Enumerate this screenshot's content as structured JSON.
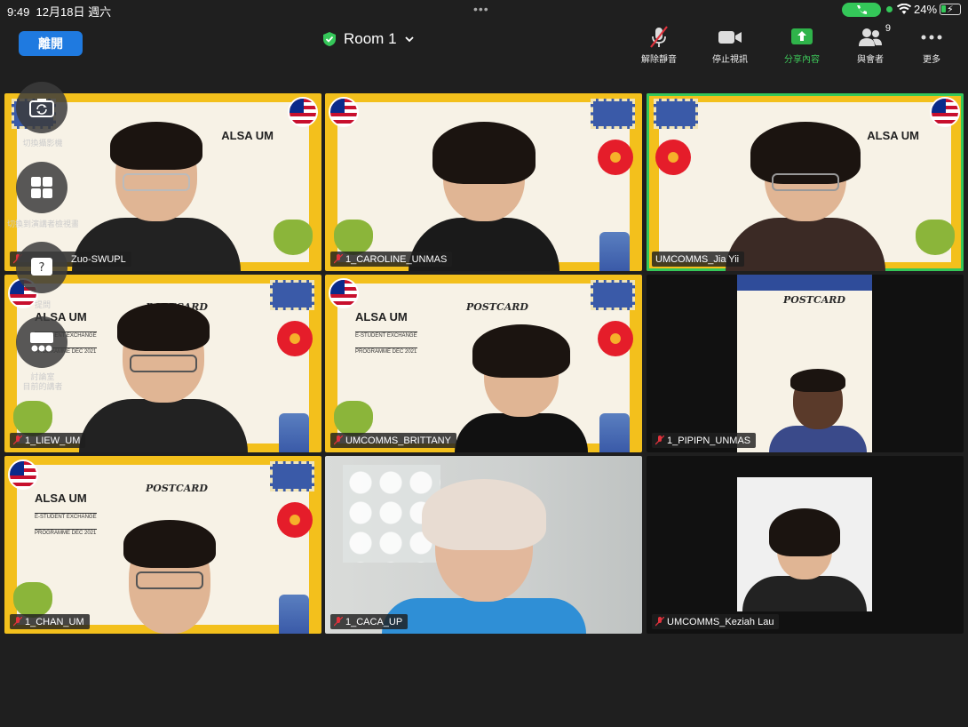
{
  "status_bar": {
    "time": "9:49",
    "date": "12月18日 週六",
    "battery_percent": "24%",
    "battery_level": 0.24
  },
  "toolbar": {
    "leave_label": "離開",
    "room_name": "Room 1",
    "items": [
      {
        "label": "解除靜音",
        "icon": "mic-muted-icon"
      },
      {
        "label": "停止視訊",
        "icon": "video-camera-icon"
      },
      {
        "label": "分享內容",
        "icon": "share-screen-icon"
      },
      {
        "label": "與會者",
        "icon": "participants-icon",
        "count": "9"
      },
      {
        "label": "更多",
        "icon": "more-icon"
      }
    ]
  },
  "participants": [
    {
      "name": "Zuo-SWUPL",
      "muted": true
    },
    {
      "name": "1_CAROLINE_UNMAS",
      "muted": true
    },
    {
      "name": "UMCOMMS_Jia Yii",
      "muted": false,
      "active_speaker": true
    },
    {
      "name": "1_LIEW_UM",
      "muted": true
    },
    {
      "name": "UMCOMMS_BRITTANY",
      "muted": true
    },
    {
      "name": "1_PIPIPN_UNMAS",
      "muted": true
    },
    {
      "name": "1_CHAN_UM",
      "muted": true
    },
    {
      "name": "1_CACA_UP",
      "muted": true
    },
    {
      "name": "UMCOMMS_Keziah Lau",
      "muted": true
    }
  ],
  "background_card": {
    "title": "ALSA UM",
    "line1": "E-STUDENT EXCHANGE",
    "line2": "PROGRAMME DEC 2021",
    "postcard": "POSTCARD"
  },
  "side_controls": [
    {
      "label": "切換攝影機",
      "icon": "camera-switch-icon"
    },
    {
      "label": "切換到演講者檢視畫面",
      "icon": "gallery-view-icon"
    },
    {
      "label": "提問",
      "icon": "question-icon"
    },
    {
      "label": "討論室\n目前的講者",
      "icon": "breakout-room-icon"
    }
  ],
  "colors": {
    "leave_button": "#1f7ae0",
    "active_speaker_border": "#35c759",
    "share_accent": "#3ec85a",
    "background": "#1f1f1f"
  }
}
